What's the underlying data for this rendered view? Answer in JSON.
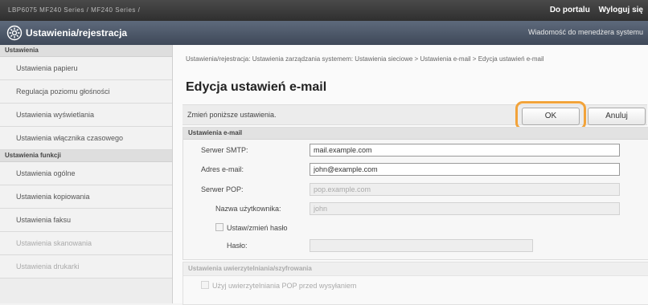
{
  "header": {
    "device_info": "LBP6075   MF240 Series / MF240 Series /",
    "portal_link": "Do portalu",
    "logout_link": "Wyloguj się"
  },
  "titlebar": {
    "title": "Ustawienia/rejestracja",
    "admin_message_link": "Wiadomość do menedżera systemu"
  },
  "sidebar": {
    "group1": "Ustawienia",
    "items1": [
      "Ustawienia papieru",
      "Regulacja poziomu głośności",
      "Ustawienia wyświetlania",
      "Ustawienia włącznika czasowego"
    ],
    "group2": "Ustawienia funkcji",
    "items2": [
      "Ustawienia ogólne",
      "Ustawienia kopiowania",
      "Ustawienia faksu",
      "Ustawienia skanowania",
      "Ustawienia drukarki"
    ]
  },
  "main": {
    "breadcrumb": "Ustawienia/rejestracja: Ustawienia zarządzania systemem: Ustawienia sieciowe > Ustawienia e-mail > Edycja ustawień e-mail",
    "page_title": "Edycja ustawień e-mail",
    "instruction": "Zmień poniższe ustawienia.",
    "ok_label": "OK",
    "cancel_label": "Anuluj",
    "section_title": "Ustawienia e-mail",
    "smtp_label": "Serwer SMTP:",
    "smtp_value": "mail.example.com",
    "email_label": "Adres e-mail:",
    "email_value": "john@example.com",
    "pop_label": "Serwer POP:",
    "pop_value": "pop.example.com",
    "username_label": "Nazwa użytkownika:",
    "username_value": "john",
    "set_password_label": "Ustaw/zmień hasło",
    "password_label": "Hasło:",
    "password_value": "",
    "auth_section_title": "Ustawienia uwierzytelniania/szyfrowania",
    "pop_before_send_label": "Użyj uwierzytelniania POP przed wysyłaniem"
  }
}
